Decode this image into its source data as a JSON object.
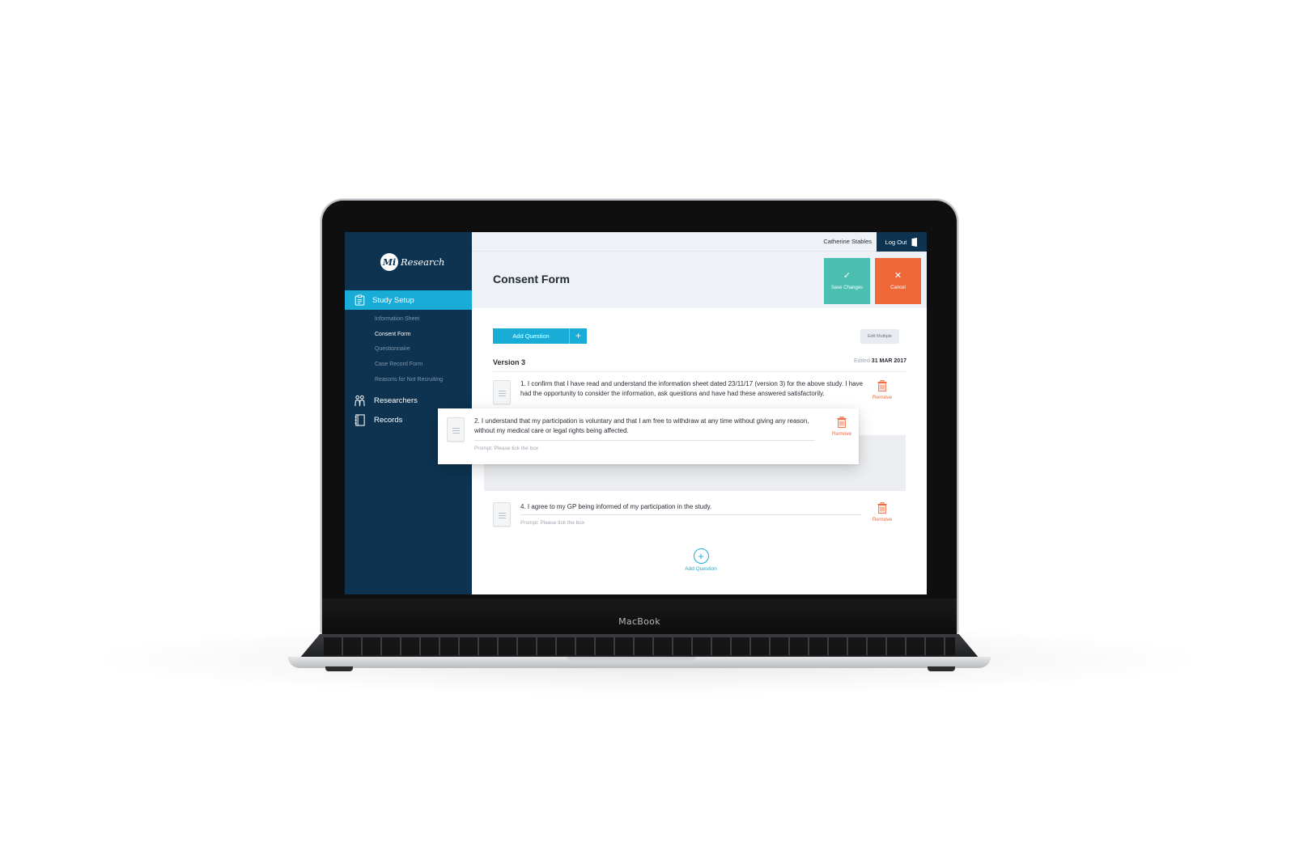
{
  "device": {
    "brand": "MacBook"
  },
  "sidebar": {
    "logo": {
      "mark": "Mi",
      "text": "Research"
    },
    "section": {
      "label": "Study Setup",
      "icon": "clipboard-icon"
    },
    "sub_items": [
      {
        "label": "Information Sheet",
        "active": false
      },
      {
        "label": "Consent Form",
        "active": true
      },
      {
        "label": "Questionnaire",
        "active": false
      },
      {
        "label": "Case Record Form",
        "active": false
      },
      {
        "label": "Reasons for Not Recruiting",
        "active": false
      }
    ],
    "nav_items": [
      {
        "label": "Researchers",
        "icon": "people-icon"
      },
      {
        "label": "Records",
        "icon": "notebook-icon"
      }
    ]
  },
  "topbar": {
    "user_name": "Catherine Stables",
    "logout_label": "Log Out",
    "logout_icon": "door-icon"
  },
  "header": {
    "title": "Consent Form",
    "save_label": "Save Changes",
    "save_icon": "check-icon",
    "cancel_label": "Cancel",
    "cancel_icon": "close-icon"
  },
  "toolbar": {
    "add_question_label": "Add Question",
    "edit_multiple_label": "Edit Multiple"
  },
  "version": {
    "label": "Version 3",
    "edited_prefix": "Edited",
    "edited_date": "31 MAR 2017"
  },
  "questions": [
    {
      "text": "1. I confirm that I have read and understand the information sheet dated 23/11/17 (version 3) for the above study.  I have had the opportunity to consider the information, ask questions and have had these answered satisfactorily.",
      "prompt": "",
      "remove_label": "Remove"
    },
    {
      "text": "2. I understand that my participation is voluntary and that I am free to withdraw at any time without giving any reason, without my medical care or legal rights being affected.",
      "prompt": "Prompt: Please tick the box",
      "remove_label": "Remove",
      "dragging": true
    },
    {
      "text": "4. I agree to my GP being informed of my participation in the study.",
      "prompt": "Prompt: Please tick the box",
      "remove_label": "Remove"
    }
  ],
  "add_question_bottom_label": "Add Question",
  "colors": {
    "sidebar": "#0d3350",
    "accent": "#19acd7",
    "save": "#4bbfb2",
    "cancel": "#f0683a",
    "remove": "#f0683a"
  }
}
